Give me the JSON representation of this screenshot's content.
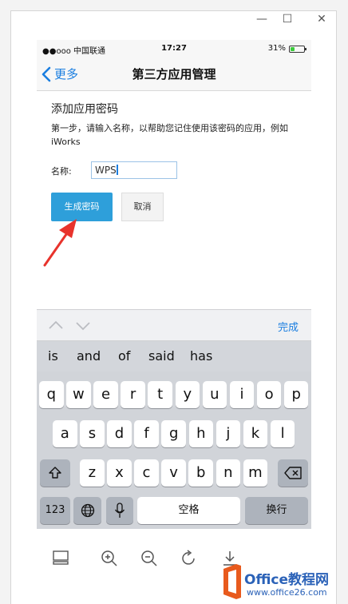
{
  "window": {
    "minimize_glyph": "—",
    "maximize_glyph": "☐",
    "close_glyph": "✕"
  },
  "statusbar": {
    "carrier": "●●ooo 中国联通",
    "time": "17:27",
    "battery_text": "31%",
    "battery_level": 0.31
  },
  "navbar": {
    "back_label": "更多",
    "title": "第三方应用管理"
  },
  "form": {
    "heading": "添加应用密码",
    "description": "第一步，请输入名称，以帮助您记住使用该密码的应用，例如 iWorks",
    "name_label": "名称:",
    "name_value": "WPS",
    "generate_label": "生成密码",
    "cancel_label": "取消"
  },
  "accessory": {
    "done_label": "完成"
  },
  "suggestions": [
    "is",
    "and",
    "of",
    "said",
    "has"
  ],
  "keyboard": {
    "row1": [
      "q",
      "w",
      "e",
      "r",
      "t",
      "y",
      "u",
      "i",
      "o",
      "p"
    ],
    "row2": [
      "a",
      "s",
      "d",
      "f",
      "g",
      "h",
      "j",
      "k",
      "l"
    ],
    "row3": [
      "z",
      "x",
      "c",
      "v",
      "b",
      "n",
      "m"
    ],
    "numbers_label": "123",
    "space_label": "空格",
    "return_label": "换行"
  },
  "watermark": {
    "title": "Office教程网",
    "url": "www.office26.com"
  },
  "colors": {
    "accent": "#1a7ee0",
    "button_blue": "#2e9fda",
    "arrow_red": "#e8332c",
    "brand": "#2b62b8"
  }
}
